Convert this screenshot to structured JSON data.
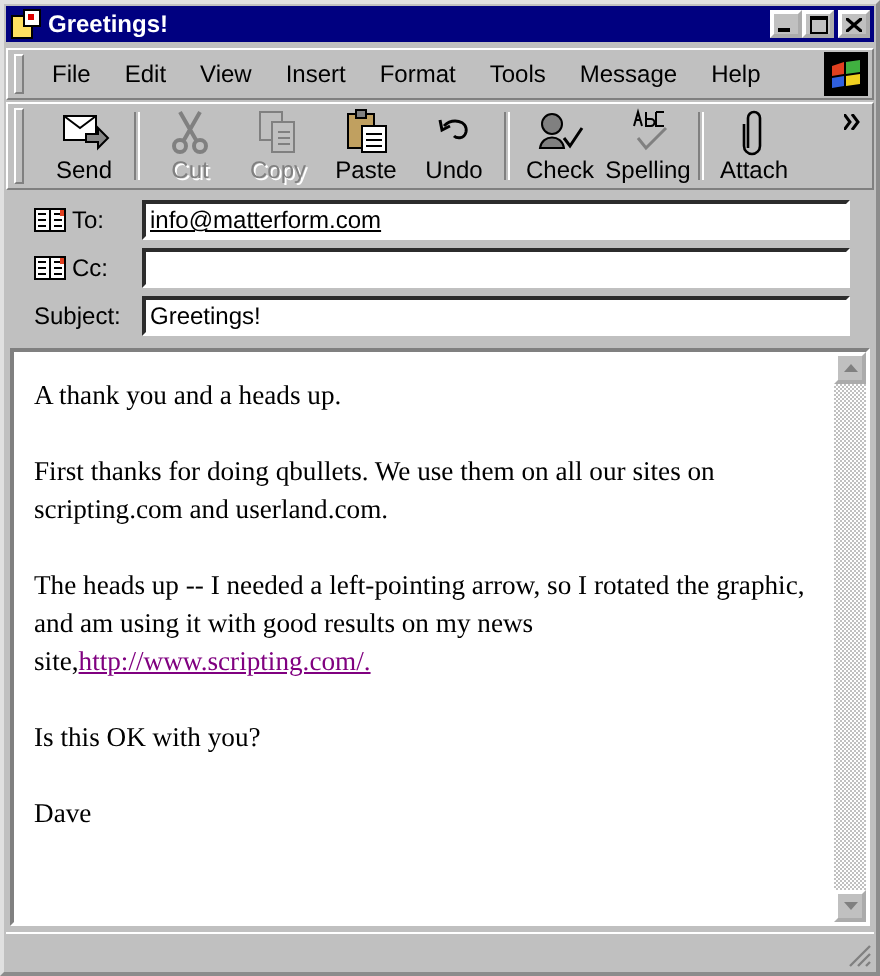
{
  "window": {
    "title": "Greetings!"
  },
  "menu": [
    "File",
    "Edit",
    "View",
    "Insert",
    "Format",
    "Tools",
    "Message",
    "Help"
  ],
  "toolbar": [
    {
      "label": "Send",
      "kind": "send",
      "disabled": false
    },
    {
      "kind": "separator"
    },
    {
      "label": "Cut",
      "kind": "cut",
      "disabled": true
    },
    {
      "label": "Copy",
      "kind": "copy",
      "disabled": true
    },
    {
      "label": "Paste",
      "kind": "paste",
      "disabled": false
    },
    {
      "label": "Undo",
      "kind": "undo",
      "disabled": false
    },
    {
      "kind": "separator"
    },
    {
      "label": "Check",
      "kind": "check",
      "disabled": false
    },
    {
      "label": "Spelling",
      "kind": "spelling",
      "disabled": false
    },
    {
      "kind": "separator"
    },
    {
      "label": "Attach",
      "kind": "attach",
      "disabled": false
    }
  ],
  "fields": [
    {
      "label": "To:",
      "address_book": true,
      "value": "info@matterform.com",
      "underlined": true
    },
    {
      "label": "Cc:",
      "address_book": true,
      "underlined": false
    },
    {
      "label": "Subject:",
      "address_book": false,
      "value": "Greetings!",
      "underlined": false
    }
  ],
  "body": [
    {
      "text": "A thank you and a heads up."
    },
    {
      "text": "First thanks for doing qbullets. We use them on all our sites on scripting.com and userland.com."
    },
    {
      "text": "The heads up -- I needed a left-pointing arrow, so I rotated the graphic, and am using it with good results on my news site,",
      "link": "http://www.scripting.com/."
    },
    {
      "text": "Is this OK with you?"
    },
    {
      "text": "Dave"
    }
  ]
}
